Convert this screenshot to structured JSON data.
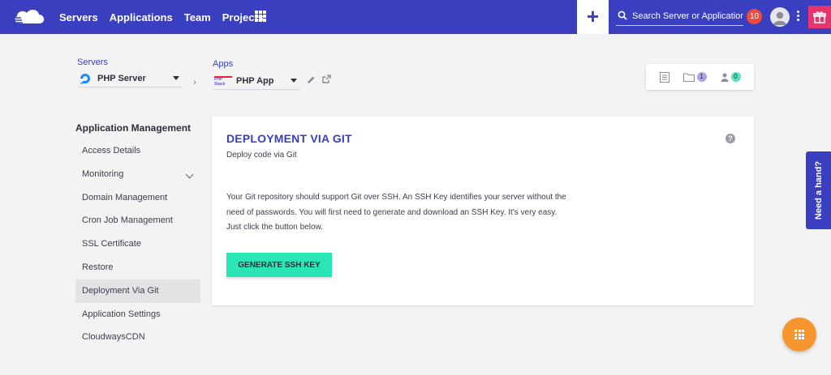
{
  "header": {
    "nav": [
      "Servers",
      "Applications",
      "Team",
      "Projects"
    ],
    "search_placeholder": "Search Server or Application",
    "notification_count": "10",
    "plus_label": "+",
    "colors": {
      "bar": "#3a3fbf",
      "badge": "#ef4b3d",
      "gift": "#e8336f"
    }
  },
  "breadcrumb": {
    "servers_label": "Servers",
    "server_value": "PHP Server",
    "apps_label": "Apps",
    "app_value": "PHP App",
    "app_logo_text": "PHP Stack"
  },
  "counters": {
    "files_count": "1",
    "users_count": "0",
    "colors": {
      "files": "#a9a3e9",
      "users": "#5fe0c0"
    }
  },
  "sidebar": {
    "title": "Application Management",
    "items": [
      {
        "label": "Access Details"
      },
      {
        "label": "Monitoring"
      },
      {
        "label": "Domain Management"
      },
      {
        "label": "Cron Job Management"
      },
      {
        "label": "SSL Certificate"
      },
      {
        "label": "Restore"
      },
      {
        "label": "Deployment Via Git"
      },
      {
        "label": "Application Settings"
      },
      {
        "label": "CloudwaysCDN"
      }
    ],
    "active_index": 6
  },
  "main": {
    "title": "DEPLOYMENT VIA GIT",
    "subtitle": "Deploy code via Git",
    "help_glyph": "?",
    "description_lines": [
      "Your Git repository should support Git over SSH. An SSH Key identifies your server without the",
      "need of passwords. You will first need to generate and download an SSH Key. It's very easy.",
      "Just click the button below."
    ],
    "button_label": "GENERATE SSH KEY",
    "button_color": "#2ae6b7"
  },
  "help_tab": {
    "label": "Need a hand?"
  }
}
